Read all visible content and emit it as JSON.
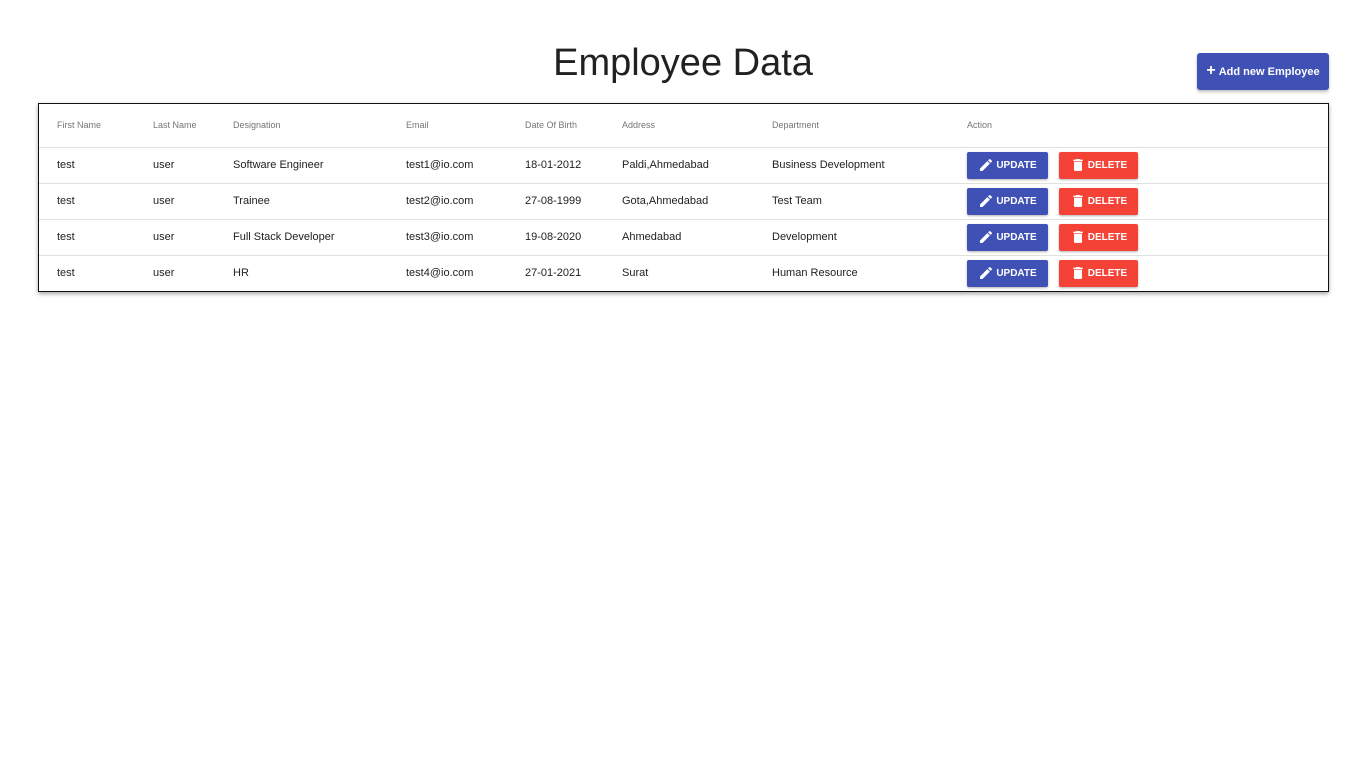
{
  "page": {
    "title": "Employee Data"
  },
  "toolbar": {
    "add_label": "Add new Employee",
    "add_icon": "plus-icon"
  },
  "colors": {
    "primary": "#3f51b5",
    "danger": "#f44336"
  },
  "table": {
    "headers": [
      "First Name",
      "Last Name",
      "Designation",
      "Email",
      "Date Of Birth",
      "Address",
      "Department",
      "Action"
    ],
    "update_label": "UPDATE",
    "delete_label": "DELETE",
    "rows": [
      {
        "first_name": "test",
        "last_name": "user",
        "designation": "Software Engineer",
        "email": "test1@io.com",
        "dob": "18-01-2012",
        "address": "Paldi,Ahmedabad",
        "department": "Business Development"
      },
      {
        "first_name": "test",
        "last_name": "user",
        "designation": "Trainee",
        "email": "test2@io.com",
        "dob": "27-08-1999",
        "address": "Gota,Ahmedabad",
        "department": "Test Team"
      },
      {
        "first_name": "test",
        "last_name": "user",
        "designation": "Full Stack Developer",
        "email": "test3@io.com",
        "dob": "19-08-2020",
        "address": "Ahmedabad",
        "department": "Development"
      },
      {
        "first_name": "test",
        "last_name": "user",
        "designation": "HR",
        "email": "test4@io.com",
        "dob": "27-01-2021",
        "address": "Surat",
        "department": "Human Resource"
      }
    ]
  }
}
